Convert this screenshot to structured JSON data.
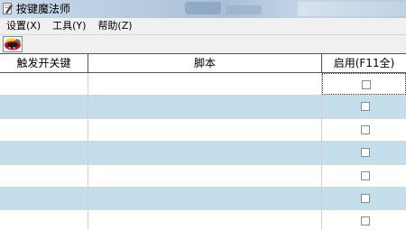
{
  "window": {
    "title": "按键魔法师"
  },
  "menu": {
    "items": [
      {
        "label": "设置(X)"
      },
      {
        "label": "工具(Y)"
      },
      {
        "label": "帮助(Z)"
      }
    ]
  },
  "toolbar": {
    "buttons": [
      {
        "icon": "color-logo-icon"
      }
    ]
  },
  "table": {
    "columns": [
      "触发开关键",
      "脚本",
      "启用(F11全)"
    ],
    "rows": [
      {
        "trigger": "",
        "script": "",
        "enabled": false
      },
      {
        "trigger": "",
        "script": "",
        "enabled": false
      },
      {
        "trigger": "",
        "script": "",
        "enabled": false
      },
      {
        "trigger": "",
        "script": "",
        "enabled": false
      },
      {
        "trigger": "",
        "script": "",
        "enabled": false
      },
      {
        "trigger": "",
        "script": "",
        "enabled": false
      },
      {
        "trigger": "",
        "script": "",
        "enabled": false
      }
    ]
  },
  "colors": {
    "row_alt": "#c4dfeb",
    "row_plain": "#ffffff",
    "menubar_bg": "#f0f0f0"
  }
}
